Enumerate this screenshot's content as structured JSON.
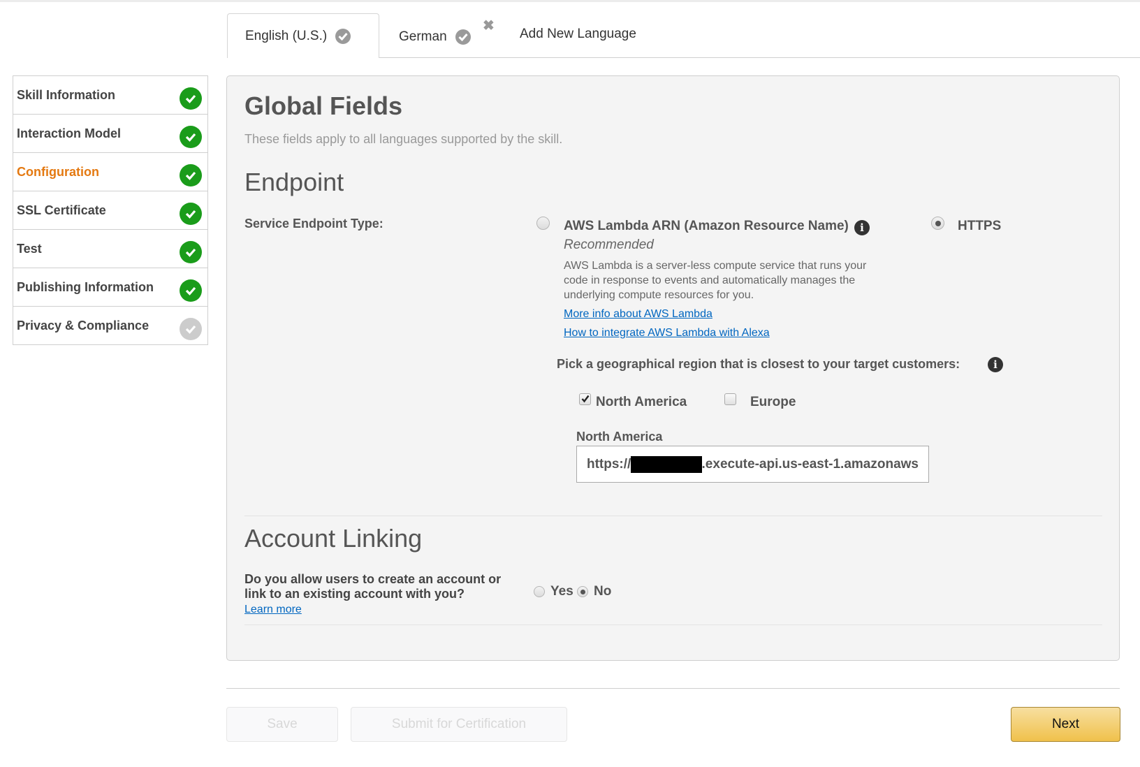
{
  "language_tabs": [
    {
      "label": "English (U.S.)",
      "status": "complete",
      "active": true
    },
    {
      "label": "German",
      "status": "complete",
      "active": false,
      "removable": true
    }
  ],
  "add_language_label": "Add New Language",
  "sidebar": {
    "items": [
      {
        "label": "Skill Information",
        "status": "complete",
        "active": false
      },
      {
        "label": "Interaction Model",
        "status": "complete",
        "active": false
      },
      {
        "label": "Configuration",
        "status": "complete",
        "active": true
      },
      {
        "label": "SSL Certificate",
        "status": "complete",
        "active": false
      },
      {
        "label": "Test",
        "status": "complete",
        "active": false
      },
      {
        "label": "Publishing Information",
        "status": "complete",
        "active": false
      },
      {
        "label": "Privacy & Compliance",
        "status": "pending",
        "active": false
      }
    ]
  },
  "global_fields": {
    "title": "Global Fields",
    "subtitle": "These fields apply to all languages supported by the skill."
  },
  "endpoint": {
    "title": "Endpoint",
    "type_label": "Service Endpoint Type:",
    "options": {
      "lambda": {
        "label": "AWS Lambda ARN (Amazon Resource Name)",
        "tag": "Recommended",
        "description": "AWS Lambda is a server-less compute service that runs your code in response to events and automatically manages the underlying compute resources for you.",
        "links": [
          "More info about AWS Lambda",
          "How to integrate AWS Lambda with Alexa"
        ],
        "selected": false
      },
      "https": {
        "label": "HTTPS",
        "selected": true
      }
    },
    "region_prompt": "Pick a geographical region that is closest to your target customers:",
    "regions": [
      {
        "label": "North America",
        "checked": true
      },
      {
        "label": "Europe",
        "checked": false
      }
    ],
    "na_field_label": "North America",
    "na_url_prefix": "https://",
    "na_url_suffix": ".execute-api.us-east-1.amazonaws"
  },
  "account_linking": {
    "title": "Account Linking",
    "question": "Do you allow users to create an account or link to an existing account with you?",
    "learn_more": "Learn more",
    "options": [
      {
        "label": "Yes",
        "selected": false
      },
      {
        "label": "No",
        "selected": true
      }
    ]
  },
  "footer": {
    "save_label": "Save",
    "submit_label": "Submit for Certification",
    "next_label": "Next"
  },
  "colors": {
    "active_step": "#e47911",
    "complete": "#1a9c1a",
    "pending": "#cccccc",
    "link": "#0066c0",
    "next_button": "#f0c14b"
  }
}
